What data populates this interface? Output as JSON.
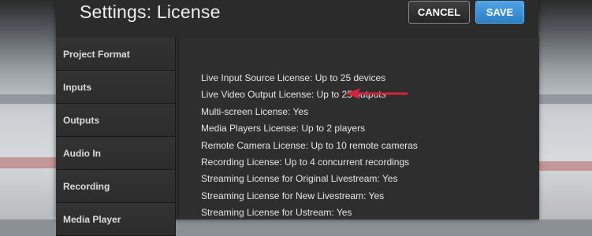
{
  "dialog": {
    "title": "Settings: License",
    "cancel_label": "CANCEL",
    "save_label": "SAVE"
  },
  "sidebar": {
    "items": [
      {
        "label": "Project Format"
      },
      {
        "label": "Inputs"
      },
      {
        "label": "Outputs"
      },
      {
        "label": "Audio In"
      },
      {
        "label": "Recording"
      },
      {
        "label": "Media Player"
      }
    ]
  },
  "licenses": [
    "Live Input Source License: Up to 25 devices",
    "Live Video Output License: Up to 25 outputs",
    "Multi-screen License: Yes",
    "Media Players License: Up to 2 players",
    "Remote Camera License: Up to 10 remote cameras",
    "Recording License: Up to 4 concurrent recordings",
    "Streaming License for Original Livestream: Yes",
    "Streaming License for New Livestream: Yes",
    "Streaming License for Ustream: Yes"
  ],
  "annotation": {
    "arrow_color": "#d4233a",
    "points_to": "licenses.1"
  }
}
